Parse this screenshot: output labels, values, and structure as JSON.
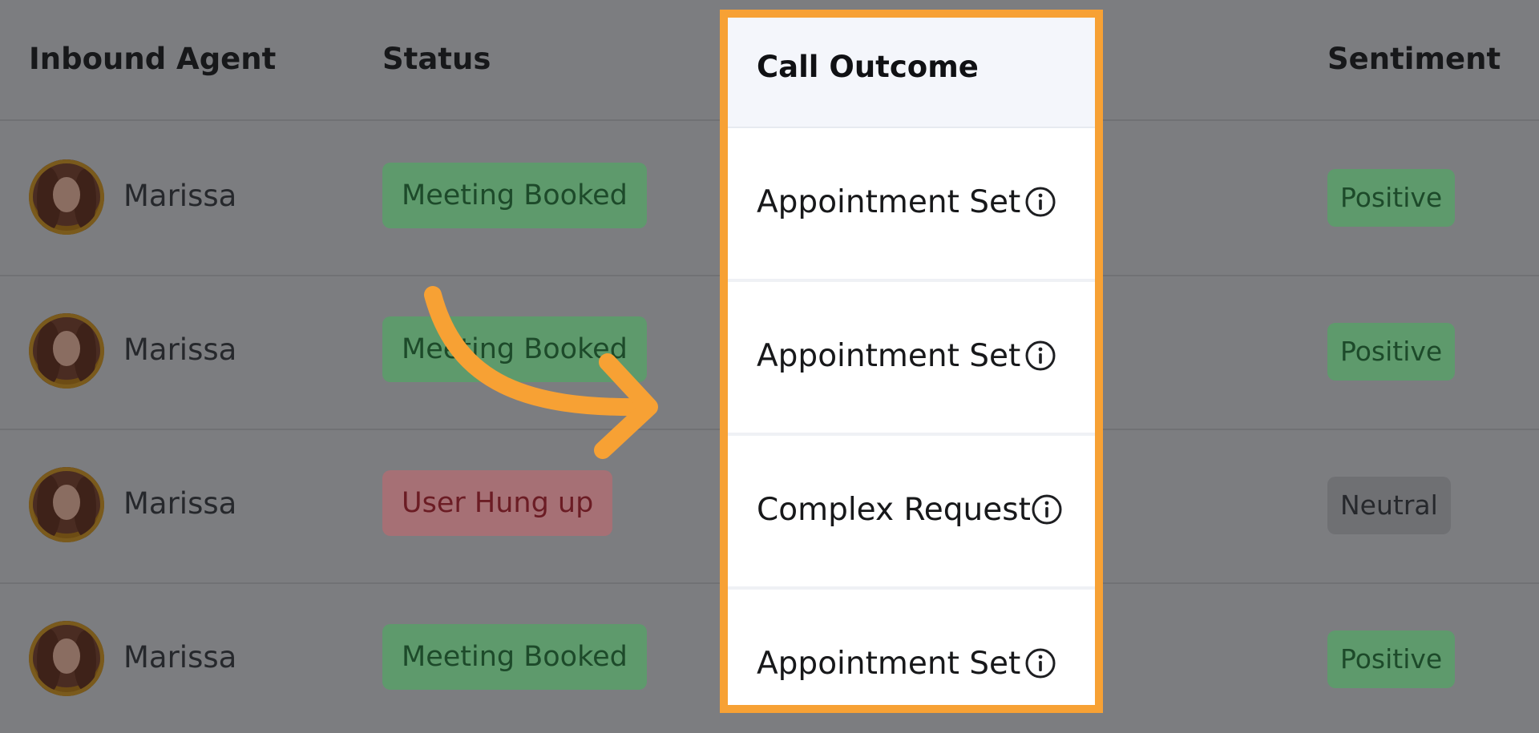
{
  "columns": {
    "agent": "Inbound Agent",
    "status": "Status",
    "outcome": "Call Outcome",
    "sentiment": "Sentiment"
  },
  "rows": [
    {
      "agent": "Marissa",
      "status": "Meeting Booked",
      "status_color": "green",
      "outcome": "Appointment Set",
      "sentiment": "Positive",
      "sentiment_color": "green"
    },
    {
      "agent": "Marissa",
      "status": "Meeting Booked",
      "status_color": "green",
      "outcome": "Appointment Set",
      "sentiment": "Positive",
      "sentiment_color": "green"
    },
    {
      "agent": "Marissa",
      "status": "User Hung up",
      "status_color": "red",
      "outcome": "Complex Request",
      "sentiment": "Neutral",
      "sentiment_color": "gray"
    },
    {
      "agent": "Marissa",
      "status": "Meeting Booked",
      "status_color": "green",
      "outcome": "Appointment Set",
      "sentiment": "Positive",
      "sentiment_color": "green"
    }
  ],
  "colors": {
    "highlight_border": "#f7a134",
    "arrow": "#f7a134",
    "overlay": "#7c7d80"
  },
  "icons": {
    "outcome_info": "info-circle-icon",
    "arrow": "curved-arrow-right-icon"
  }
}
